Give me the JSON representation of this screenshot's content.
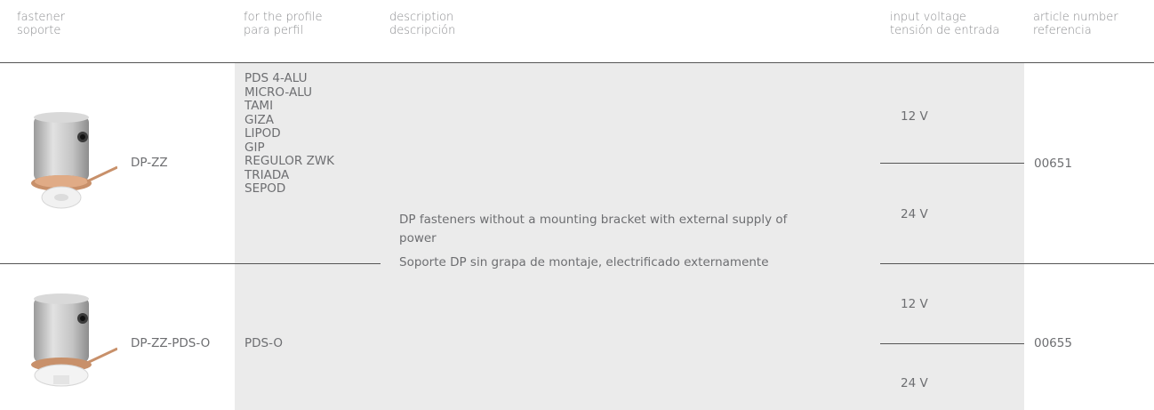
{
  "header": {
    "fastener": {
      "en": "fastener",
      "es": "soporte"
    },
    "profile": {
      "en": "for the profile",
      "es": "para perfil"
    },
    "description": {
      "en": "description",
      "es": "descripción"
    },
    "voltage": {
      "en": "input voltage",
      "es": "tensión de entrada"
    },
    "article": {
      "en": "article number",
      "es": "referencia"
    }
  },
  "description": {
    "en": "DP fasteners without a mounting bracket with external supply of power",
    "es": "Soporte DP sin grapa de montaje, electrificado externamente"
  },
  "rows": [
    {
      "name": "DP-ZZ",
      "profiles": [
        "PDS 4-ALU",
        "MICRO-ALU",
        "TAMI",
        "GIZA",
        "LIPOD",
        "GIP",
        "REGULOR ZWK",
        "TRIADA",
        "SEPOD"
      ],
      "voltages": [
        "12 V",
        "24 V"
      ],
      "article": "00651"
    },
    {
      "name": "DP-ZZ-PDS-O",
      "profiles": [
        "PDS-O"
      ],
      "voltages": [
        "12 V",
        "24 V"
      ],
      "article": "00655"
    }
  ],
  "colors": {
    "cell_bg": "#ebebeb",
    "text": "#6d6e71",
    "rule": "#555555"
  }
}
